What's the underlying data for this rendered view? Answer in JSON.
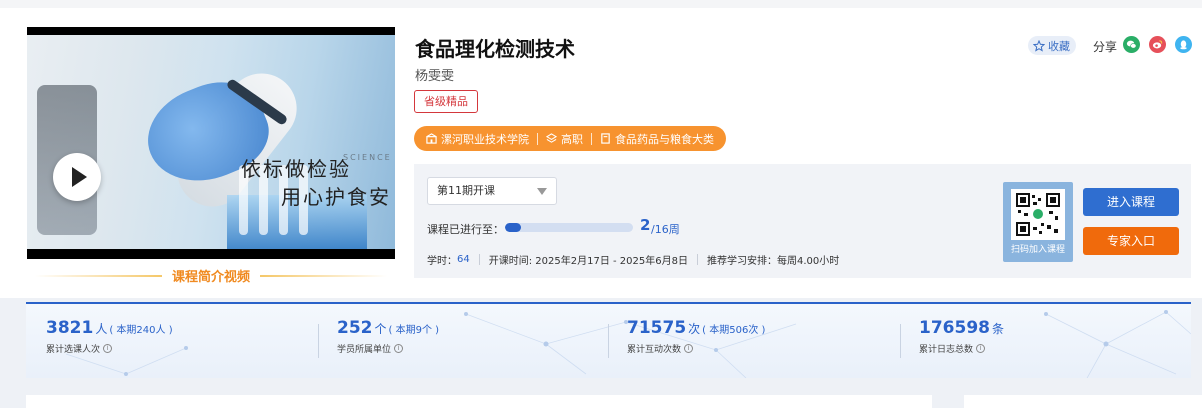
{
  "video": {
    "overlay_line1": "依标做检验",
    "overlay_line2": "用心护食安",
    "overlay_small": "SCIENCE",
    "caption": "课程简介视频"
  },
  "course": {
    "title": "食品理化检测技术",
    "teacher": "杨雯雯",
    "level_badge": "省级精品",
    "tags": [
      {
        "icon": "school-icon",
        "label": "漯河职业技术学院"
      },
      {
        "icon": "layers-icon",
        "label": "高职"
      },
      {
        "icon": "book-icon",
        "label": "食品药品与粮食大类"
      }
    ]
  },
  "actions": {
    "favorite_label": "收藏",
    "share_label": "分享",
    "share_targets": [
      {
        "icon": "wechat-icon",
        "color": "#2aae67"
      },
      {
        "icon": "weibo-icon",
        "color": "#e6505a"
      },
      {
        "icon": "qq-icon",
        "color": "#3fb4f0"
      }
    ]
  },
  "term": {
    "selected": "第11期开课",
    "progress_label": "课程已进行至：",
    "progress_current": "2",
    "progress_total_text": "/16周",
    "progress_fraction": 0.125,
    "hours_label": "学时：",
    "hours_value": "64",
    "dates": "开课时间: 2025年2月17日 - 2025年6月8日",
    "schedule": "推荐学习安排：每周4.00小时"
  },
  "qr": {
    "caption": "扫码加入课程"
  },
  "buttons": {
    "enter": "进入课程",
    "expert": "专家入口"
  },
  "stats": [
    {
      "value": "3821",
      "unit": "人",
      "sub": "( 本期240人 )",
      "label": "累计选课人次"
    },
    {
      "value": "252",
      "unit": "个",
      "sub": "( 本期9个 )",
      "label": "学员所属单位"
    },
    {
      "value": "71575",
      "unit": "次",
      "sub": "( 本期506次 )",
      "label": "累计互动次数"
    },
    {
      "value": "176598",
      "unit": "条",
      "sub": "",
      "label": "累计日志总数"
    }
  ],
  "colors": {
    "primary": "#2a62c9",
    "orange": "#f7932f",
    "red": "#d4373c",
    "expert": "#f06a0c"
  }
}
